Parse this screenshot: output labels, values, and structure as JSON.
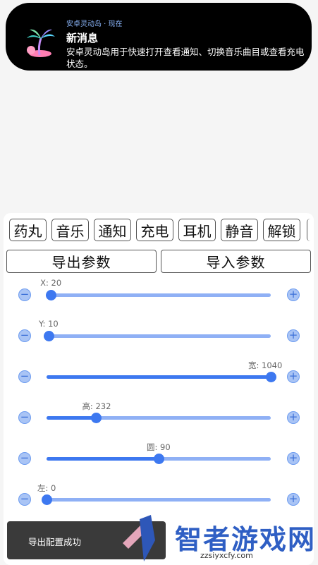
{
  "notification": {
    "meta": "安卓灵动岛 · 现在",
    "title": "新消息",
    "body": "安卓灵动岛用于快速打开查看通知、切换音乐曲目或查看充电状态。",
    "logo_icon": "palm-tree-icon"
  },
  "mode_tabs": [
    "药丸",
    "音乐",
    "通知",
    "充电",
    "耳机",
    "静音",
    "解锁"
  ],
  "actions": {
    "export_label": "导出参数",
    "import_label": "导入参数"
  },
  "sliders": [
    {
      "label": "X: 20",
      "value": 20,
      "max": 1040
    },
    {
      "label": "Y: 10",
      "value": 10,
      "max": 1040
    },
    {
      "label": "宽: 1040",
      "value": 1040,
      "max": 1040
    },
    {
      "label": "高: 232",
      "value": 232,
      "max": 1040
    },
    {
      "label": "圆: 90",
      "value": 90,
      "max": 180
    },
    {
      "label": "左: 0",
      "value": 0,
      "max": 1040
    }
  ],
  "controls": {
    "minus_symbol": "−",
    "plus_symbol": "+"
  },
  "toast": {
    "message": "导出配置成功"
  },
  "watermark": {
    "text": "智者游戏网",
    "url": "zzsiyxcfy.com"
  },
  "colors": {
    "accent": "#3d78f0",
    "track": "#8fb0f5",
    "island_bg": "#000000"
  }
}
